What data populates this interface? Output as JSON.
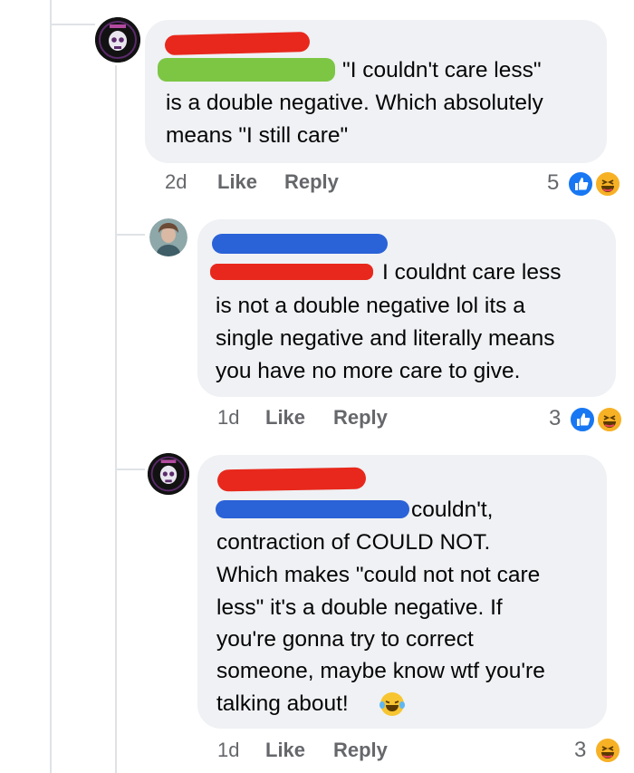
{
  "comments": [
    {
      "text_inline": "\"I couldn't care less\"",
      "text_lines": [
        "is a double negative. Which absolutely",
        "means \"I still care\""
      ],
      "time": "2d",
      "like_label": "Like",
      "reply_label": "Reply",
      "reaction_count": "5",
      "reactions": [
        "like-icon",
        "haha-icon"
      ],
      "name_redaction_color": "#e8281c",
      "mention_redaction_color": "#7cc644"
    },
    {
      "text_inline": "I couldnt care less",
      "text_lines": [
        "is not a double negative lol its a",
        "single negative and literally means",
        "you have no more care to give."
      ],
      "time": "1d",
      "like_label": "Like",
      "reply_label": "Reply",
      "reaction_count": "3",
      "reactions": [
        "like-icon",
        "haha-icon"
      ],
      "name_redaction_color": "#2a62d8",
      "mention_redaction_color": "#e8281c"
    },
    {
      "text_inline": "couldn't,",
      "text_lines": [
        "contraction of COULD NOT.",
        "Which makes \"could not not care",
        "less\" it's a double negative. If",
        "you're gonna try to correct",
        "someone, maybe know wtf you're",
        "talking about!"
      ],
      "time": "1d",
      "like_label": "Like",
      "reply_label": "Reply",
      "reaction_count": "3",
      "reactions": [
        "haha-icon"
      ],
      "name_redaction_color": "#e8281c",
      "mention_redaction_color": "#2a62d8",
      "end_emoji": "laughing-tears-icon"
    }
  ],
  "colors": {
    "bubble": "#eff1f4",
    "meta": "#65676b",
    "like_blue": "#1877f2",
    "haha_yellow": "#f7b125"
  }
}
